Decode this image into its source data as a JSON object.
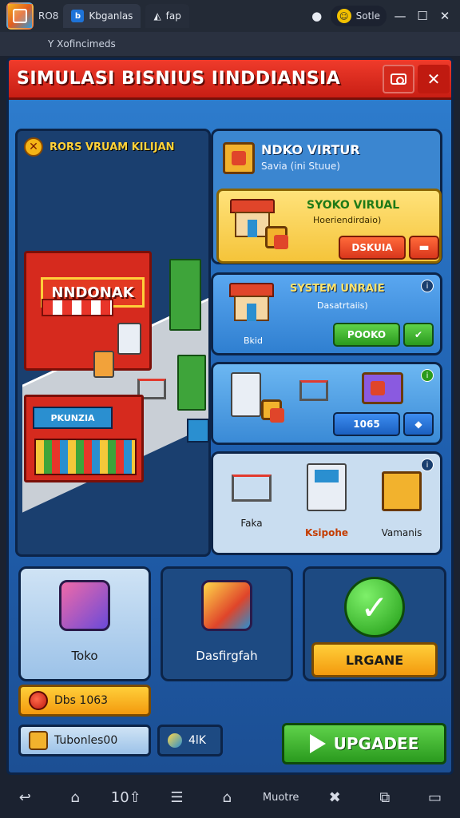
{
  "emulator": {
    "logo_label": "RO8",
    "tabs": [
      {
        "label": "Kbganlas",
        "icon": "emulator-app-icon"
      },
      {
        "label": "fap",
        "icon": "game-icon"
      }
    ],
    "help_icon": "question-icon",
    "user": {
      "avatar": "☺",
      "name": "Sotle"
    },
    "subtitle": "Y Xofincimeds"
  },
  "game": {
    "title": "SIMULASI BISNIUS IINDDIANSIA",
    "store": {
      "header": "RORS VRUAM KILIJAN",
      "main_sign": "NNDONAK",
      "sub_sign": "PKUNZIA"
    },
    "cards": {
      "top": {
        "title": "NDKO VIRTUR",
        "subtitle": "Savia (ini Stuue)",
        "sub_title": "SYOKO VIRUAL",
        "sub_subtitle": "Hoeriendirdaio)",
        "button": "DSKUIA"
      },
      "mid": {
        "title": "SYSTEM UNRAIE",
        "subtitle": "Dasatrtaiis)",
        "house_label": "Bkid",
        "button": "POOKO"
      },
      "mid2": {
        "button": "1065"
      },
      "bottom": {
        "items": [
          {
            "label": "Faka",
            "highlight": false
          },
          {
            "label": "Ksipohe",
            "highlight": true
          },
          {
            "label": "Vamanis",
            "highlight": false
          }
        ]
      }
    },
    "tiles": {
      "toko": "Toko",
      "dash": "Dasfirgfah",
      "check_button": "LRGANE"
    },
    "pills": {
      "dbs": "Dbs 1063",
      "tub": "Tubonles00",
      "coin": "4lK"
    },
    "upgrade_button": "UPGADEE"
  },
  "navbar": {
    "items": [
      {
        "label": "↩",
        "icon": "back-icon"
      },
      {
        "label": "⌂",
        "icon": "home-outline-icon"
      },
      {
        "label": "10⇧",
        "icon": "upload-icon"
      },
      {
        "label": "☰",
        "icon": "menu-icon"
      },
      {
        "label": "⌂",
        "icon": "home-icon"
      },
      {
        "label": "Muotre",
        "icon": "more-text"
      },
      {
        "label": "✖",
        "icon": "tools-icon"
      },
      {
        "label": "⧉",
        "icon": "window-icon"
      },
      {
        "label": "▭",
        "icon": "multi-window-icon"
      }
    ]
  },
  "colors": {
    "title_red": "#c81e14",
    "game_blue": "#2f7fd0",
    "button_green": "#2a9a1e",
    "button_orange": "#f39a0e"
  }
}
